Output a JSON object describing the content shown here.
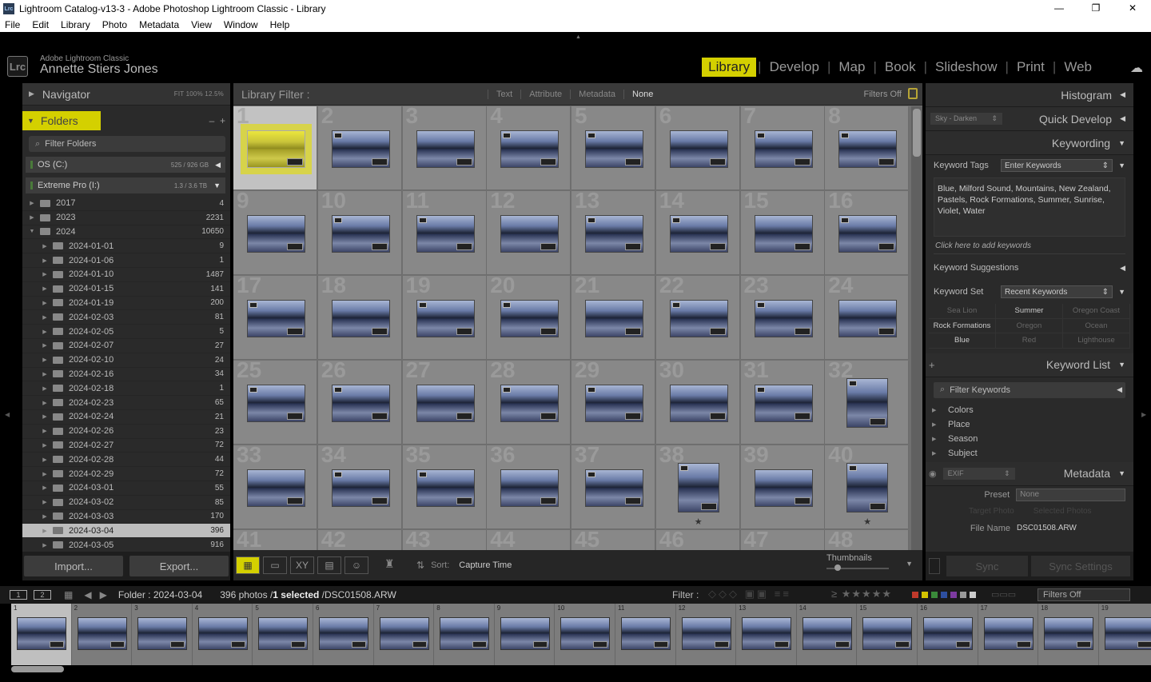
{
  "window": {
    "title": "Lightroom Catalog-v13-3 - Adobe Photoshop Lightroom Classic - Library",
    "icon": "Lrc",
    "controls": [
      "—",
      "❐",
      "✕"
    ]
  },
  "menu": [
    "File",
    "Edit",
    "Library",
    "Photo",
    "Metadata",
    "View",
    "Window",
    "Help"
  ],
  "identity": {
    "logo": "Lrc",
    "product": "Adobe Lightroom Classic",
    "user": "Annette Stiers Jones"
  },
  "modules": [
    "Library",
    "Develop",
    "Map",
    "Book",
    "Slideshow",
    "Print",
    "Web"
  ],
  "active_module": "Library",
  "navigator": {
    "title": "Navigator",
    "zoom": "FIT   100%   12.5%"
  },
  "folders": {
    "title": "Folders",
    "filter_placeholder": "Filter Folders",
    "volumes": [
      {
        "name": "OS (C:)",
        "capacity": "525 / 926 GB"
      },
      {
        "name": "Extreme Pro (I:)",
        "capacity": "1.3 / 3.6 TB"
      }
    ],
    "years": [
      {
        "name": "2017",
        "count": "4"
      },
      {
        "name": "2023",
        "count": "2231"
      },
      {
        "name": "2024",
        "count": "10650"
      }
    ],
    "subfolders": [
      {
        "name": "2024-01-01",
        "count": "9"
      },
      {
        "name": "2024-01-06",
        "count": "1"
      },
      {
        "name": "2024-01-10",
        "count": "1487"
      },
      {
        "name": "2024-01-15",
        "count": "141"
      },
      {
        "name": "2024-01-19",
        "count": "200"
      },
      {
        "name": "2024-02-03",
        "count": "81"
      },
      {
        "name": "2024-02-05",
        "count": "5"
      },
      {
        "name": "2024-02-07",
        "count": "27"
      },
      {
        "name": "2024-02-10",
        "count": "24"
      },
      {
        "name": "2024-02-16",
        "count": "34"
      },
      {
        "name": "2024-02-18",
        "count": "1"
      },
      {
        "name": "2024-02-23",
        "count": "65"
      },
      {
        "name": "2024-02-24",
        "count": "21"
      },
      {
        "name": "2024-02-26",
        "count": "23"
      },
      {
        "name": "2024-02-27",
        "count": "72"
      },
      {
        "name": "2024-02-28",
        "count": "44"
      },
      {
        "name": "2024-02-29",
        "count": "72"
      },
      {
        "name": "2024-03-01",
        "count": "55"
      },
      {
        "name": "2024-03-02",
        "count": "85"
      },
      {
        "name": "2024-03-03",
        "count": "170"
      },
      {
        "name": "2024-03-04",
        "count": "396"
      },
      {
        "name": "2024-03-05",
        "count": "916"
      }
    ],
    "selected": "2024-03-04"
  },
  "left_buttons": {
    "import": "Import...",
    "export": "Export..."
  },
  "library_filter": {
    "title": "Library Filter :",
    "modes": [
      "Text",
      "Attribute",
      "Metadata",
      "None"
    ],
    "active": "None",
    "status": "Filters Off"
  },
  "grid": {
    "columns": 8,
    "cell_numbers": [
      "1",
      "2",
      "3",
      "4",
      "5",
      "6",
      "7",
      "8",
      "9",
      "10",
      "11",
      "12",
      "13",
      "14",
      "15",
      "16",
      "17",
      "18",
      "19",
      "20",
      "21",
      "22",
      "23",
      "24",
      "25",
      "26",
      "27",
      "28",
      "29",
      "30",
      "31",
      "32",
      "33",
      "34",
      "35",
      "36",
      "37",
      "38",
      "39",
      "40",
      "41",
      "42",
      "43",
      "44",
      "45",
      "46",
      "47",
      "48"
    ],
    "portrait_cells": [
      32,
      38,
      40
    ],
    "starred_cells": [
      38,
      40
    ],
    "selected_cell": 1
  },
  "toolbar": {
    "sort_label": "Sort:",
    "sort_value": "Capture Time",
    "thumbnails_label": "Thumbnails"
  },
  "right": {
    "histogram": "Histogram",
    "quick_develop": {
      "title": "Quick Develop",
      "preset": "Sky - Darken"
    },
    "keywording": {
      "title": "Keywording",
      "tags_label": "Keyword Tags",
      "tags_value": "Enter Keywords",
      "keywords": "Blue, Milford Sound, Mountains, New Zealand, Pastels, Rock Formations, Summer, Sunrise, Violet, Water",
      "add_hint": "Click here to add keywords",
      "suggestions": "Keyword Suggestions",
      "set_label": "Keyword Set",
      "set_value": "Recent Keywords",
      "set_items": [
        {
          "label": "Sea Lion",
          "on": false
        },
        {
          "label": "Summer",
          "on": true
        },
        {
          "label": "Oregon Coast",
          "on": false
        },
        {
          "label": "Rock Formations",
          "on": true
        },
        {
          "label": "Oregon",
          "on": false
        },
        {
          "label": "Ocean",
          "on": false
        },
        {
          "label": "Blue",
          "on": true
        },
        {
          "label": "Red",
          "on": false
        },
        {
          "label": "Lighthouse",
          "on": false
        }
      ]
    },
    "keyword_list": {
      "title": "Keyword List",
      "add": "+",
      "filter_placeholder": "Filter Keywords",
      "items": [
        "Colors",
        "Place",
        "Season",
        "Subject"
      ]
    },
    "metadata": {
      "title": "Metadata",
      "view": "EXIF",
      "preset_label": "Preset",
      "preset_value": "None",
      "target_photo": "Target Photo",
      "selected_photos": "Selected Photos",
      "filename_label": "File Name",
      "filename": "DSC01508.ARW"
    },
    "sync": "Sync",
    "sync_settings": "Sync Settings"
  },
  "filmbar": {
    "monitor1": "1",
    "monitor2": "2",
    "folder": "Folder : 2024-03-04",
    "count_prefix": "396 photos /",
    "selected": "1 selected",
    "file": "/DSC01508.ARW",
    "filter_label": "Filter :",
    "filter_value": "Filters Off",
    "label_colors": [
      "#c0392b",
      "#d4c300",
      "#3a8a3a",
      "#2d4fa0",
      "#7d3aa0",
      "#999999",
      "#cccccc"
    ]
  },
  "filmstrip": {
    "numbers": [
      "1",
      "2",
      "3",
      "4",
      "5",
      "6",
      "7",
      "8",
      "9",
      "10",
      "11",
      "12",
      "13",
      "14",
      "15",
      "16",
      "17",
      "18",
      "19"
    ],
    "selected": 1
  }
}
